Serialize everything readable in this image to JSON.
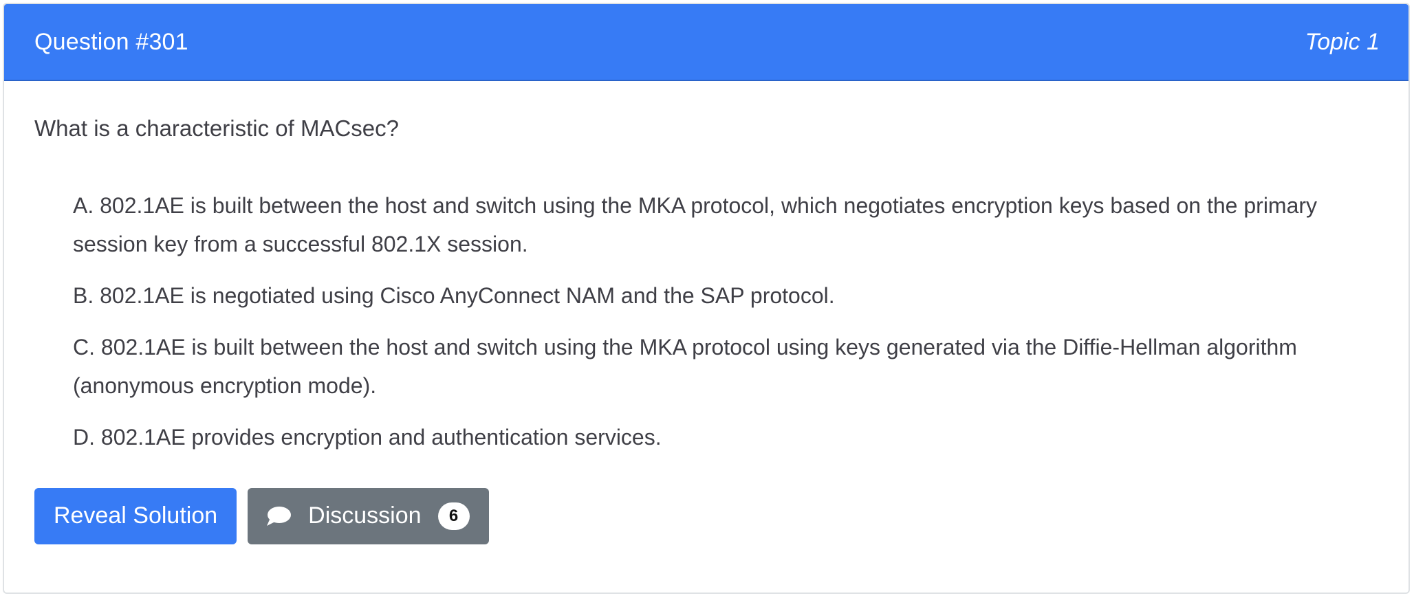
{
  "header": {
    "question_label": "Question #301",
    "topic_label": "Topic 1"
  },
  "question": {
    "text": "What is a characteristic of MACsec?"
  },
  "choices": [
    {
      "text": "A. 802.1AE is built between the host and switch using the MKA protocol, which negotiates encryption keys based on the primary session key from a successful 802.1X session."
    },
    {
      "text": "B. 802.1AE is negotiated using Cisco AnyConnect NAM and the SAP protocol."
    },
    {
      "text": "C. 802.1AE is built between the host and switch using the MKA protocol using keys generated via the Diffie-Hellman algorithm (anonymous encryption mode)."
    },
    {
      "text": "D. 802.1AE provides encryption and authentication services."
    }
  ],
  "actions": {
    "reveal_label": "Reveal Solution",
    "discussion_label": "Discussion",
    "discussion_count": "6",
    "discussion_icon": "comment-icon"
  },
  "colors": {
    "accent": "#377bf5",
    "secondary": "#6c757d",
    "text": "#3f3f46"
  }
}
